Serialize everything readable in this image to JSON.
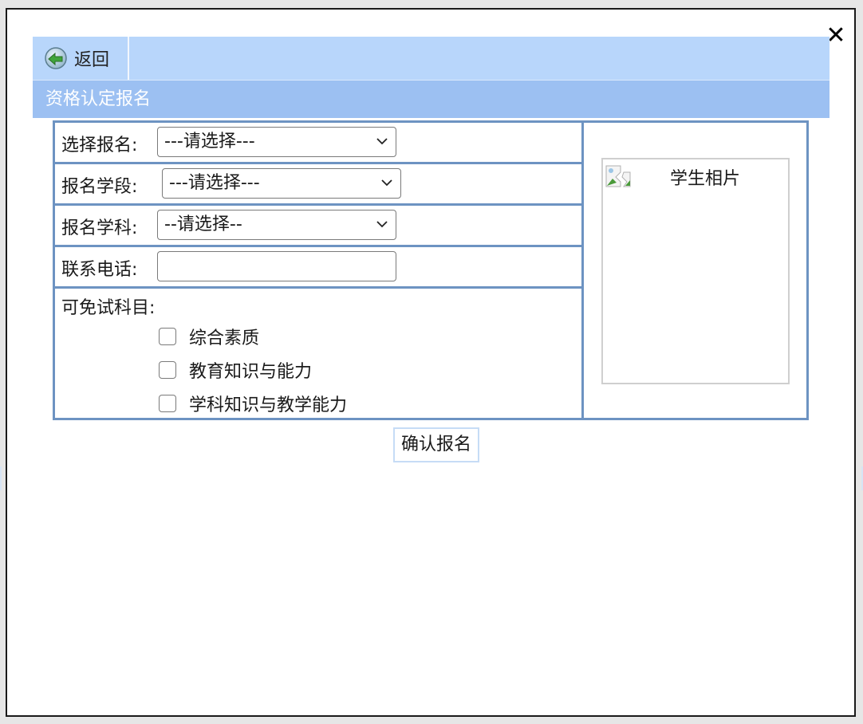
{
  "dialog": {
    "close_icon": "close-icon",
    "close_symbol": "✕"
  },
  "toolbar": {
    "back_label": "返回",
    "back_icon": "back-arrow-icon"
  },
  "title": "资格认定报名",
  "form": {
    "fields": [
      {
        "label": "选择报名:",
        "value": "---请选择---"
      },
      {
        "label": "报名学段:",
        "value": "---请选择---"
      },
      {
        "label": "报名学科:",
        "value": "--请选择--"
      },
      {
        "label": "联系电话:",
        "value": ""
      }
    ],
    "exempt": {
      "label": "可免试科目:",
      "options": [
        {
          "label": "综合素质",
          "checked": false
        },
        {
          "label": "教育知识与能力",
          "checked": false
        },
        {
          "label": "学科知识与教学能力",
          "checked": false
        }
      ]
    }
  },
  "photo": {
    "alt": "学生相片",
    "icon": "broken-image-icon"
  },
  "confirm_label": "确认报名",
  "colors": {
    "toolbar_bg": "#b8d6fb",
    "title_bg": "#9cc0f2",
    "table_border": "#6d93c2"
  }
}
